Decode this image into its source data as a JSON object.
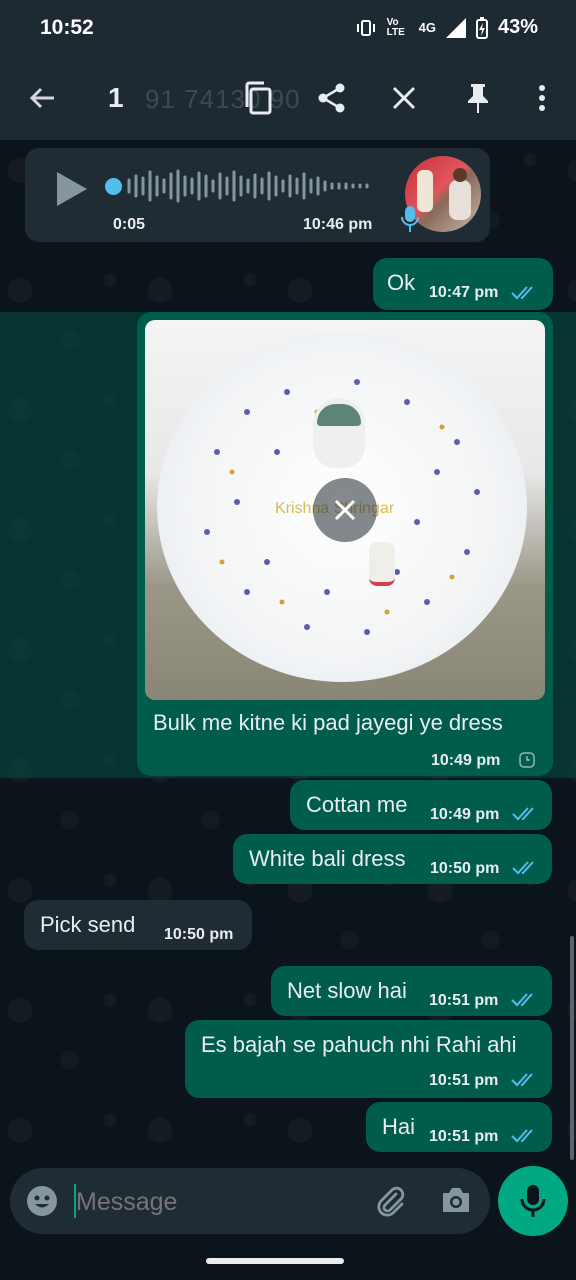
{
  "status_bar": {
    "time": "10:52",
    "network": "4G",
    "volte": "Vo LTE",
    "battery": "43%"
  },
  "action_bar": {
    "selected_count": "1",
    "faded_text": "91 74130 90"
  },
  "messages": {
    "voice": {
      "duration": "0:05",
      "time": "10:46 pm"
    },
    "ok": {
      "text": "Ok",
      "time": "10:47 pm"
    },
    "image": {
      "watermark": "Krishna Shringar",
      "caption": "Bulk me kitne ki pad jayegi ye dress",
      "time": "10:49 pm"
    },
    "cottan": {
      "text": "Cottan me",
      "time": "10:49 pm"
    },
    "white": {
      "text": "White bali dress",
      "time": "10:50 pm"
    },
    "pick": {
      "text": "Pick send",
      "time": "10:50 pm"
    },
    "net": {
      "text": "Net slow hai",
      "time": "10:51 pm"
    },
    "es": {
      "text": "Es bajah se pahuch nhi Rahi ahi",
      "time": "10:51 pm"
    },
    "hai": {
      "text": "Hai",
      "time": "10:51 pm"
    }
  },
  "composer": {
    "placeholder": "Message"
  },
  "colors": {
    "outgoing": "#005c4b",
    "incoming": "#202c33",
    "accent": "#00a884",
    "read_ticks": "#53bdeb"
  }
}
